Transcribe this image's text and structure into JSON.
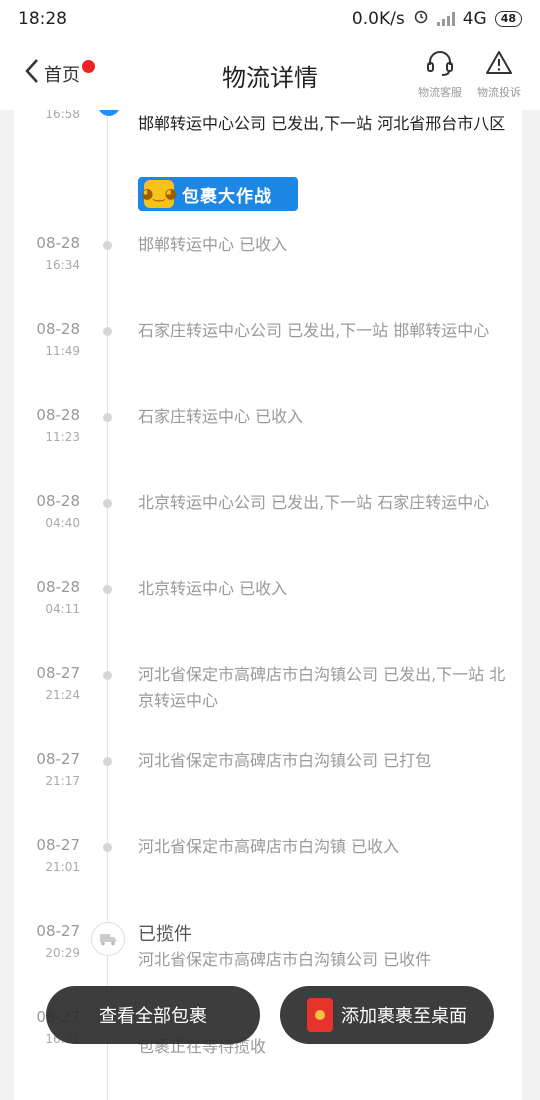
{
  "status_bar": {
    "time": "18:28",
    "network_speed": "0.0K/s",
    "network": "4G",
    "battery": "48"
  },
  "header": {
    "back_label": "首页",
    "title": "物流详情",
    "service_label": "物流客服",
    "complaint_label": "物流投诉"
  },
  "banner": {
    "label": "包裹大作战"
  },
  "timeline": [
    {
      "date": "",
      "time": "16:58",
      "text": "邯郸转运中心公司 已发出,下一站 河北省邢台市八区",
      "active": true
    },
    {
      "date": "08-28",
      "time": "16:34",
      "text": "邯郸转运中心 已收入"
    },
    {
      "date": "08-28",
      "time": "11:49",
      "text": "石家庄转运中心公司 已发出,下一站 邯郸转运中心"
    },
    {
      "date": "08-28",
      "time": "11:23",
      "text": "石家庄转运中心 已收入"
    },
    {
      "date": "08-28",
      "time": "04:40",
      "text": "北京转运中心公司 已发出,下一站 石家庄转运中心"
    },
    {
      "date": "08-28",
      "time": "04:11",
      "text": "北京转运中心 已收入"
    },
    {
      "date": "08-27",
      "time": "21:24",
      "text": "河北省保定市高碑店市白沟镇公司 已发出,下一站 北京转运中心"
    },
    {
      "date": "08-27",
      "time": "21:17",
      "text": "河北省保定市高碑店市白沟镇公司 已打包"
    },
    {
      "date": "08-27",
      "time": "21:01",
      "text": "河北省保定市高碑店市白沟镇 已收入"
    },
    {
      "date": "08-27",
      "time": "20:29",
      "stage": "已揽件",
      "text": "河北省保定市高碑店市白沟镇公司 已收件",
      "icon": "truck-icon"
    },
    {
      "date": "08-27",
      "time": "16:31",
      "text": "包裹正在等待揽收"
    }
  ],
  "bottom": {
    "view_all_label": "查看全部包裹",
    "add_to_desktop_label": "添加裹裹至桌面"
  }
}
